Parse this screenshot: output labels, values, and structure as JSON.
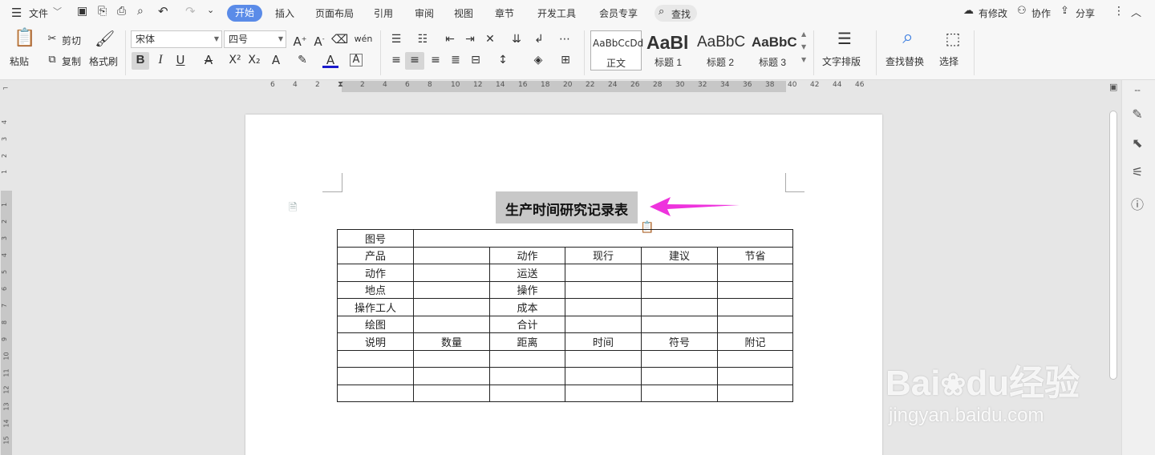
{
  "menu": {
    "file": "文件",
    "tabs": [
      "开始",
      "插入",
      "页面布局",
      "引用",
      "审阅",
      "视图",
      "章节",
      "开发工具",
      "会员专享"
    ],
    "search": "查找",
    "right": {
      "changes": "有修改",
      "collab": "协作",
      "share": "分享"
    }
  },
  "ribbon": {
    "paste": "粘贴",
    "cut": "剪切",
    "copy": "复制",
    "format_painter": "格式刷",
    "font": "宋体",
    "size": "四号",
    "styles": [
      {
        "preview": "AaBbCcDd",
        "name": "正文"
      },
      {
        "preview": "AaBl",
        "name": "标题 1"
      },
      {
        "preview": "AaBbC",
        "name": "标题 2"
      },
      {
        "preview": "AaBbC",
        "name": "标题 3"
      }
    ],
    "text_layout": "文字排版",
    "find_replace": "查找替换",
    "select": "选择"
  },
  "ruler": {
    "h_numbers": [
      "6",
      "4",
      "2",
      "2",
      "4",
      "6",
      "8",
      "10",
      "12",
      "14",
      "16",
      "18",
      "20",
      "22",
      "24",
      "26",
      "28",
      "30",
      "32",
      "34",
      "36",
      "38",
      "40",
      "42",
      "44",
      "46"
    ],
    "v_numbers": [
      "4",
      "3",
      "2",
      "1",
      "1",
      "2",
      "3",
      "4",
      "5",
      "6",
      "7",
      "8",
      "9",
      "10",
      "11",
      "12",
      "13",
      "14",
      "15"
    ]
  },
  "document": {
    "title": "生产时间研究记录表",
    "rows": [
      [
        "图号",
        "",
        "",
        "",
        "",
        ""
      ],
      [
        "产品",
        "",
        "动作",
        "现行",
        "建议",
        "节省"
      ],
      [
        "动作",
        "",
        "运送",
        "",
        "",
        ""
      ],
      [
        "地点",
        "",
        "操作",
        "",
        "",
        ""
      ],
      [
        "操作工人",
        "",
        "成本",
        "",
        "",
        ""
      ],
      [
        "绘图",
        "",
        "合计",
        "",
        "",
        ""
      ],
      [
        "说明",
        "数量",
        "距离",
        "时间",
        "符号",
        "附记"
      ],
      [
        "",
        "",
        "",
        "",
        "",
        ""
      ],
      [
        "",
        "",
        "",
        "",
        "",
        ""
      ],
      [
        "",
        "",
        "",
        "",
        "",
        ""
      ]
    ]
  },
  "watermark": {
    "brand_a": "Bai",
    "brand_b": "du",
    "brand_c": "经验",
    "url": "jingyan.baidu.com"
  },
  "colors": {
    "accent": "#5a8be8",
    "arrow": "#ee33dd",
    "selection": "#c8c8c8"
  }
}
